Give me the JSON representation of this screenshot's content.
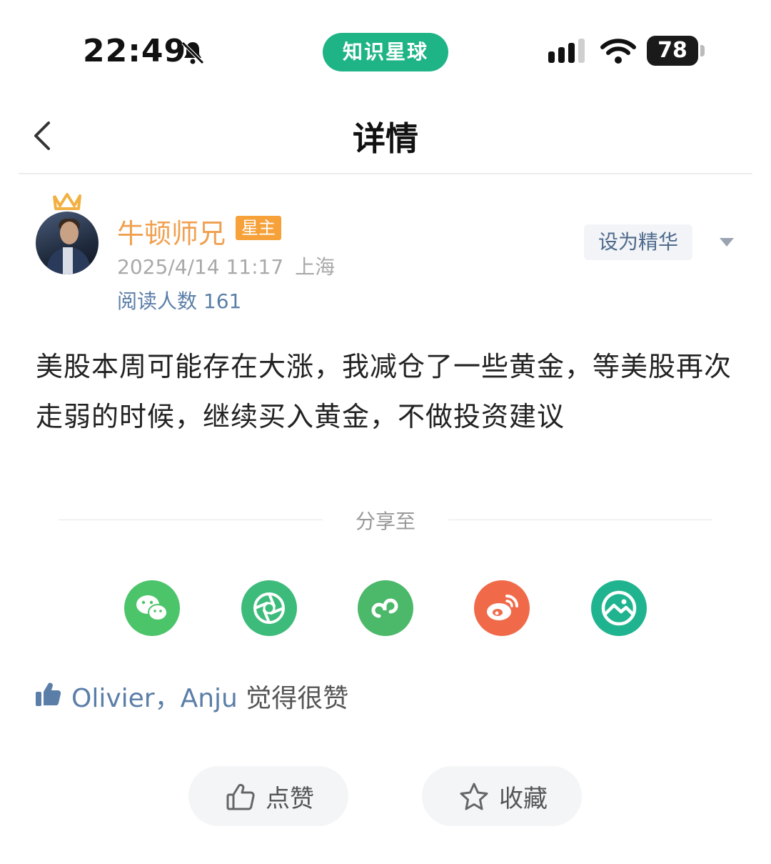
{
  "status_bar": {
    "time": "22:49",
    "app_name": "知识星球",
    "battery": "78",
    "accent": "#1fb486"
  },
  "nav": {
    "title": "详情"
  },
  "author": {
    "name": "牛顿师兄",
    "badge": "星主",
    "date": "2025/4/14 11:17",
    "location": "上海",
    "read_count": "阅读人数 161",
    "name_color": "#f0a050"
  },
  "actions": {
    "feature_label": "设为精华"
  },
  "post": {
    "body": "美股本周可能存在大涨，我减仓了一些黄金，等美股再次走弱的时候，继续买入黄金，不做投资建议"
  },
  "share": {
    "label": "分享至",
    "targets": [
      {
        "icon": "wechat-icon",
        "color": "#4cc46a"
      },
      {
        "icon": "moments-icon",
        "color": "#3dbb7b"
      },
      {
        "icon": "mini-program-icon",
        "color": "#4cb86a"
      },
      {
        "icon": "weibo-icon",
        "color": "#f06a4a"
      },
      {
        "icon": "image-icon",
        "color": "#1fb48f"
      }
    ]
  },
  "likes": {
    "names": "Olivier，Anju",
    "suffix": " 觉得很赞"
  },
  "bottom_bar": {
    "like_label": "点赞",
    "favorite_label": "收藏"
  }
}
